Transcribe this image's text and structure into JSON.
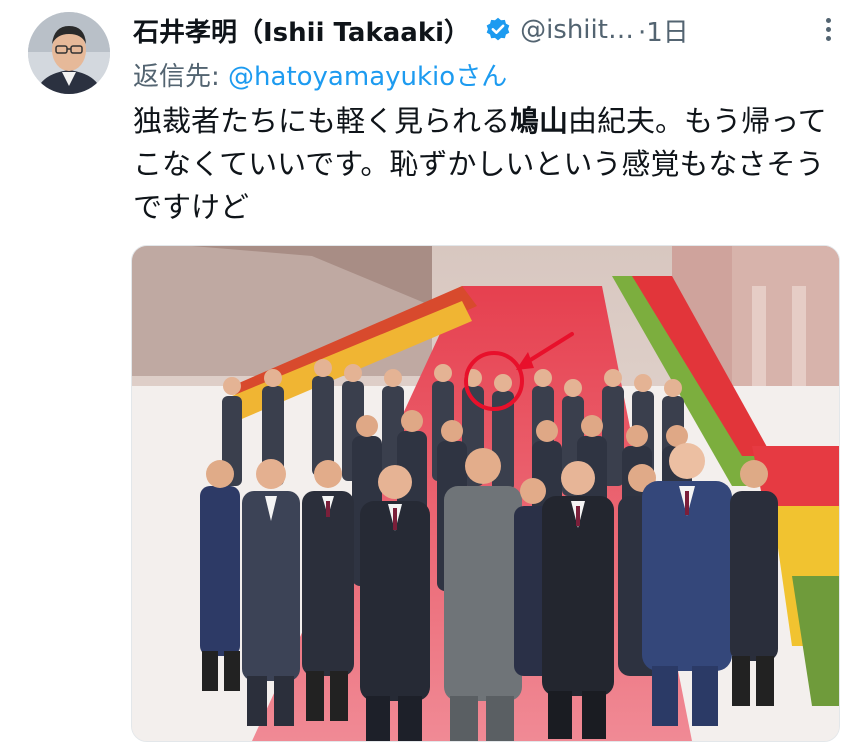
{
  "tweet": {
    "author": {
      "display_name": "石井孝明（Ishii Takaaki）",
      "handle": "@ishiit…",
      "time": "·1日",
      "avatar_icon": "user-avatar"
    },
    "reply": {
      "prefix": "返信先: ",
      "target": "@hatoyamayukio",
      "suffix": "さん"
    },
    "text": {
      "before": "独裁者たちにも軽く見られる",
      "bold": "鳩山",
      "after": "由紀夫。もう帰ってこなくていいです。恥ずかしいという感覚もなさそうですけど"
    },
    "media": {
      "annotation_icon": "red-circle-arrow-annotation"
    },
    "colors": {
      "verified": "#1d9bf0",
      "link": "#1d9bf0",
      "muted": "#536471",
      "annotation": "#e8102b"
    }
  }
}
